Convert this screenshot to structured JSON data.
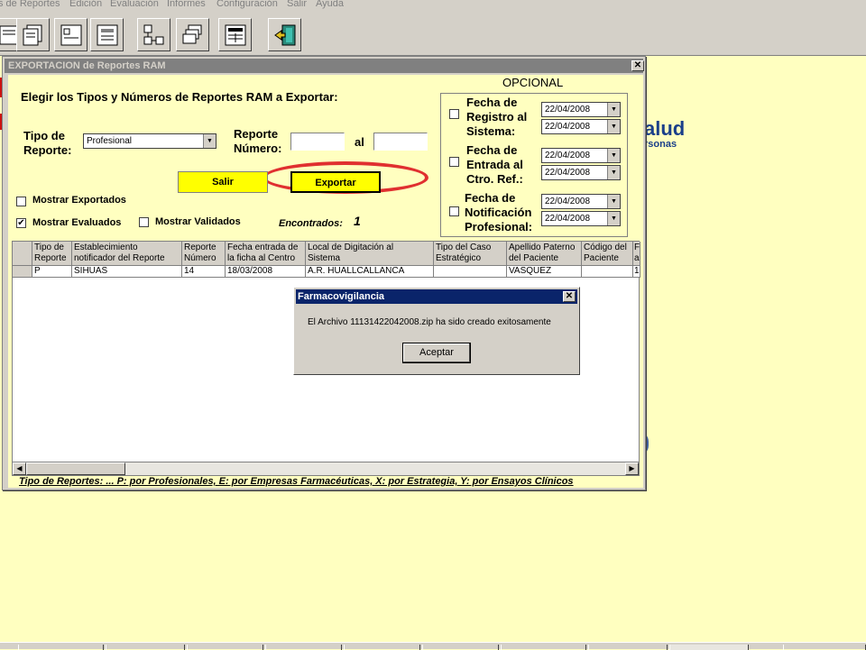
{
  "menu": [
    "s de Reportes",
    "Edición",
    "Evaluación",
    "Informes",
    "Configuración",
    "Salir",
    "Ayuda"
  ],
  "background_logo": {
    "text": "alud",
    "sub": "rsonas"
  },
  "window": {
    "title": "EXPORTACION de Reportes RAM",
    "close": "✕",
    "heading": "Elegir los Tipos y Números de Reportes RAM a Exportar:",
    "tipo_label_1": "Tipo de",
    "tipo_label_2": "Reporte:",
    "tipo_value": "Profesional",
    "reporte_label_1": "Reporte",
    "reporte_label_2": "Número:",
    "al_label": "al",
    "reporte_from": "",
    "reporte_to": "",
    "salir_button": "Salir",
    "exportar_button": "Exportar",
    "mostrar_exportados": "Mostrar Exportados",
    "mostrar_exportados_checked": false,
    "mostrar_evaluados": "Mostrar Evaluados",
    "mostrar_evaluados_checked": true,
    "mostrar_validados": "Mostrar Validados",
    "mostrar_validados_checked": false,
    "encontrados_label": "Encontrados:",
    "encontrados_count": "1",
    "opcional": {
      "title": "OPCIONAL",
      "groups": [
        {
          "label": [
            "Fecha de",
            "Registro al",
            "Sistema:"
          ],
          "from": "22/04/2008",
          "to": "22/04/2008"
        },
        {
          "label": [
            "Fecha de",
            "Entrada al",
            "Ctro. Ref.:"
          ],
          "from": "22/04/2008",
          "to": "22/04/2008"
        },
        {
          "label": [
            "Fecha de",
            "Notificación",
            "Profesional:"
          ],
          "from": "22/04/2008",
          "to": "22/04/2008"
        }
      ]
    },
    "table": {
      "columns": [
        [
          "Tipo de",
          "Reporte"
        ],
        [
          "Establecimiento",
          "notificador del Reporte"
        ],
        [
          "Reporte",
          "Número"
        ],
        [
          "Fecha entrada de",
          "la ficha al Centro"
        ],
        [
          "Local de Digitación al",
          "Sistema"
        ],
        [
          "Tipo del Caso",
          "Estratégico"
        ],
        [
          "Apellido Paterno",
          "del Paciente"
        ],
        [
          "Código del",
          "Paciente"
        ],
        [
          "F",
          "a"
        ]
      ],
      "rows": [
        [
          "P",
          "SIHUAS",
          "14",
          "18/03/2008",
          "A.R. HUALLCALLANCA",
          "",
          "VASQUEZ",
          "",
          "1"
        ]
      ]
    },
    "footer_note": "Tipo de Reportes: ... P: por Profesionales, E: por Empresas Farmacéuticas, X: por Estrategia, Y: por Ensayos Clínicos"
  },
  "dialog": {
    "title": "Farmacovigilancia",
    "message": "El Archivo 11131422042008.zip ha sido creado exitosamente",
    "ok_button": "Aceptar"
  },
  "colors": {
    "panel_bg": "#ffffc0",
    "button_yellow": "#ffff00",
    "highlight_ellipse": "#e03030",
    "dialog_title": "#0a246a"
  }
}
